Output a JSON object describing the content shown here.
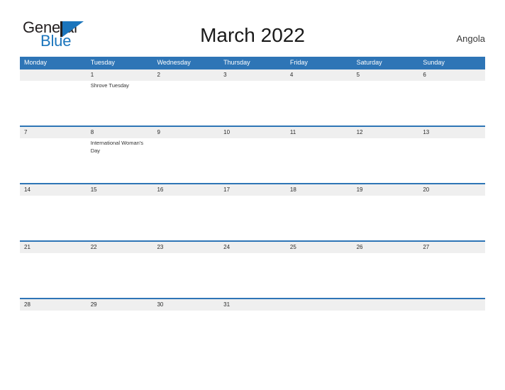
{
  "brand": {
    "name_part1": "General",
    "name_part2": "Blue",
    "mark": "pennant-triangle",
    "color_dark": "#231F20",
    "color_blue": "#1B75BC"
  },
  "header": {
    "title": "March 2022",
    "country": "Angola"
  },
  "theme": {
    "accent": "#2E75B6",
    "band": "#EFEFEF",
    "text": "#2B2B2B",
    "header_text": "#FFFFFF"
  },
  "calendar": {
    "month": "March",
    "year": "2022",
    "weekday_headers": [
      "Monday",
      "Tuesday",
      "Wednesday",
      "Thursday",
      "Friday",
      "Saturday",
      "Sunday"
    ],
    "weeks": [
      {
        "days": [
          {
            "date": "",
            "event": ""
          },
          {
            "date": "1",
            "event": "Shrove Tuesday"
          },
          {
            "date": "2",
            "event": ""
          },
          {
            "date": "3",
            "event": ""
          },
          {
            "date": "4",
            "event": ""
          },
          {
            "date": "5",
            "event": ""
          },
          {
            "date": "6",
            "event": ""
          }
        ]
      },
      {
        "days": [
          {
            "date": "7",
            "event": ""
          },
          {
            "date": "8",
            "event": "International Woman's Day"
          },
          {
            "date": "9",
            "event": ""
          },
          {
            "date": "10",
            "event": ""
          },
          {
            "date": "11",
            "event": ""
          },
          {
            "date": "12",
            "event": ""
          },
          {
            "date": "13",
            "event": ""
          }
        ]
      },
      {
        "days": [
          {
            "date": "14",
            "event": ""
          },
          {
            "date": "15",
            "event": ""
          },
          {
            "date": "16",
            "event": ""
          },
          {
            "date": "17",
            "event": ""
          },
          {
            "date": "18",
            "event": ""
          },
          {
            "date": "19",
            "event": ""
          },
          {
            "date": "20",
            "event": ""
          }
        ]
      },
      {
        "days": [
          {
            "date": "21",
            "event": ""
          },
          {
            "date": "22",
            "event": ""
          },
          {
            "date": "23",
            "event": ""
          },
          {
            "date": "24",
            "event": ""
          },
          {
            "date": "25",
            "event": ""
          },
          {
            "date": "26",
            "event": ""
          },
          {
            "date": "27",
            "event": ""
          }
        ]
      },
      {
        "days": [
          {
            "date": "28",
            "event": ""
          },
          {
            "date": "29",
            "event": ""
          },
          {
            "date": "30",
            "event": ""
          },
          {
            "date": "31",
            "event": ""
          },
          {
            "date": "",
            "event": ""
          },
          {
            "date": "",
            "event": ""
          },
          {
            "date": "",
            "event": ""
          }
        ]
      }
    ]
  }
}
